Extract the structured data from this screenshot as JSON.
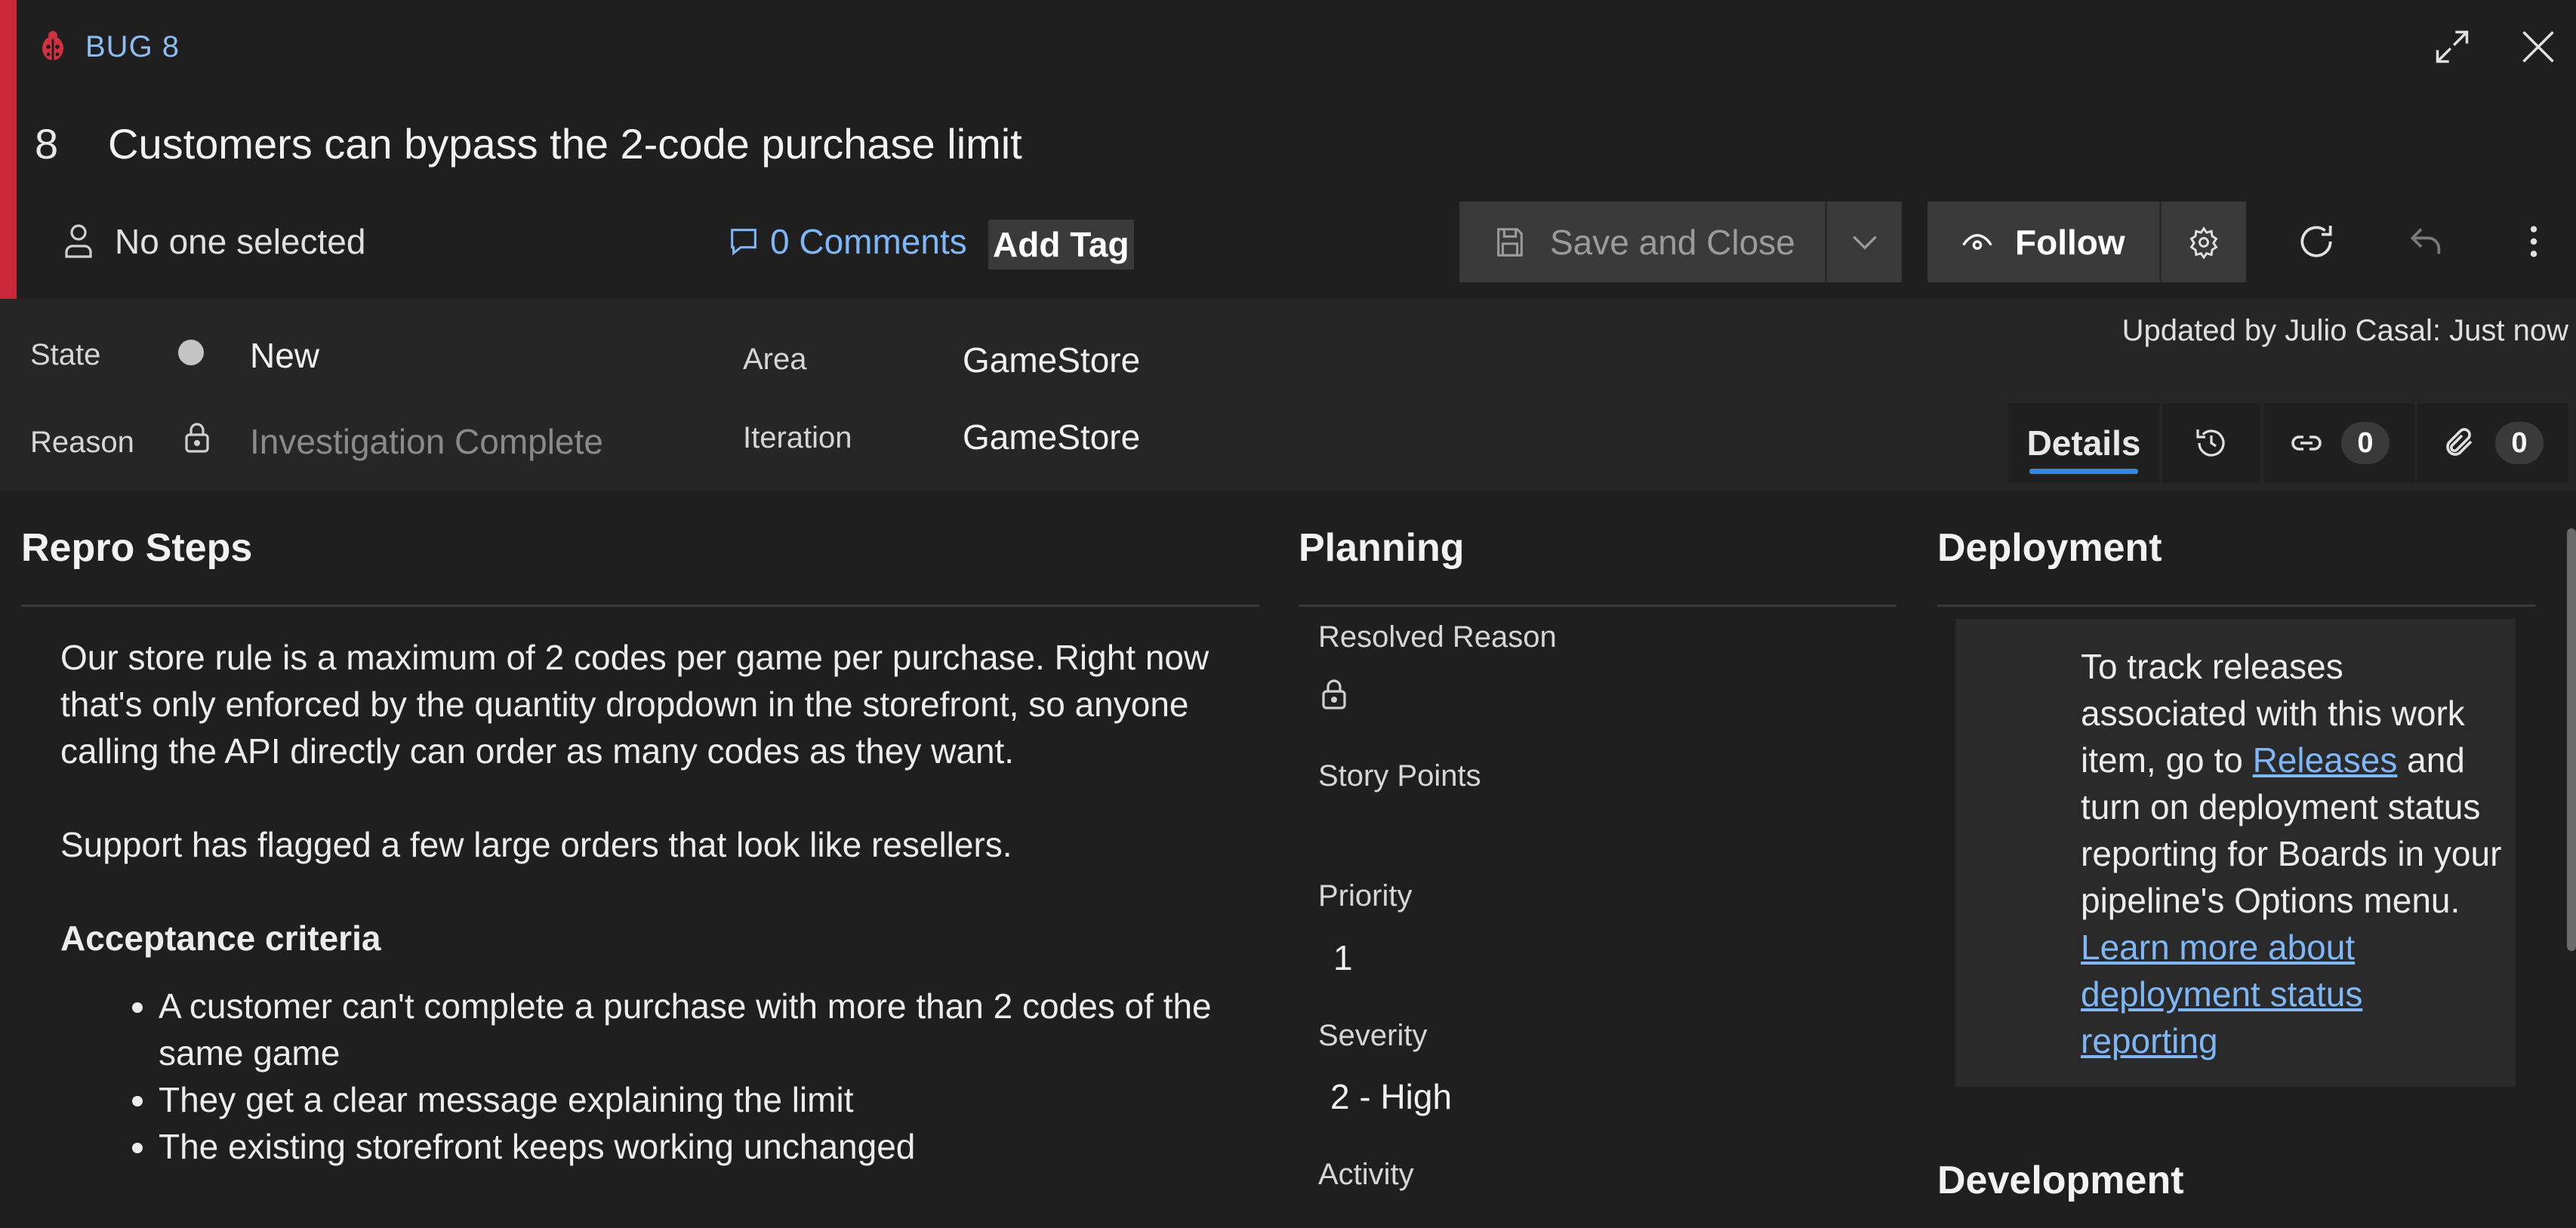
{
  "header": {
    "type_label": "BUG 8",
    "id": "8",
    "title": "Customers can bypass the 2-code purchase limit",
    "assignee": "No one selected",
    "comments": "0 Comments",
    "add_tag": "Add Tag",
    "save_label": "Save and Close",
    "follow_label": "Follow",
    "accent_color": "#c8283a"
  },
  "fields": {
    "state_label": "State",
    "state_value": "New",
    "reason_label": "Reason",
    "reason_value": "Investigation Complete",
    "area_label": "Area",
    "area_value": "GameStore",
    "iteration_label": "Iteration",
    "iteration_value": "GameStore",
    "updated_by": "Updated by Julio Casal: Just now"
  },
  "tabs": {
    "details": "Details",
    "links_count": "0",
    "attachments_count": "0"
  },
  "repro": {
    "title": "Repro Steps",
    "p1": "Our store rule is a maximum of 2 codes per game per purchase. Right now that's only enforced by the quantity dropdown in the storefront, so anyone calling the API directly can order as many codes as they want.",
    "p2": "Support has flagged a few large orders that look like resellers.",
    "criteria_title": "Acceptance criteria",
    "criteria": [
      "A customer can't complete a purchase with more than 2 codes of the same game",
      "They get a clear message explaining the limit",
      "The existing storefront keeps working unchanged"
    ]
  },
  "planning": {
    "title": "Planning",
    "resolved_reason_label": "Resolved Reason",
    "story_points_label": "Story Points",
    "priority_label": "Priority",
    "priority_value": "1",
    "severity_label": "Severity",
    "severity_value": "2 - High",
    "activity_label": "Activity"
  },
  "deployment": {
    "title": "Deployment",
    "text_1": "To track releases associated with this work item, go to ",
    "link_releases": "Releases",
    "text_2": " and turn on deployment status reporting for Boards in your pipeline's Options menu. ",
    "link_learn": "Learn more about deployment status reporting",
    "dev_title": "Development"
  }
}
